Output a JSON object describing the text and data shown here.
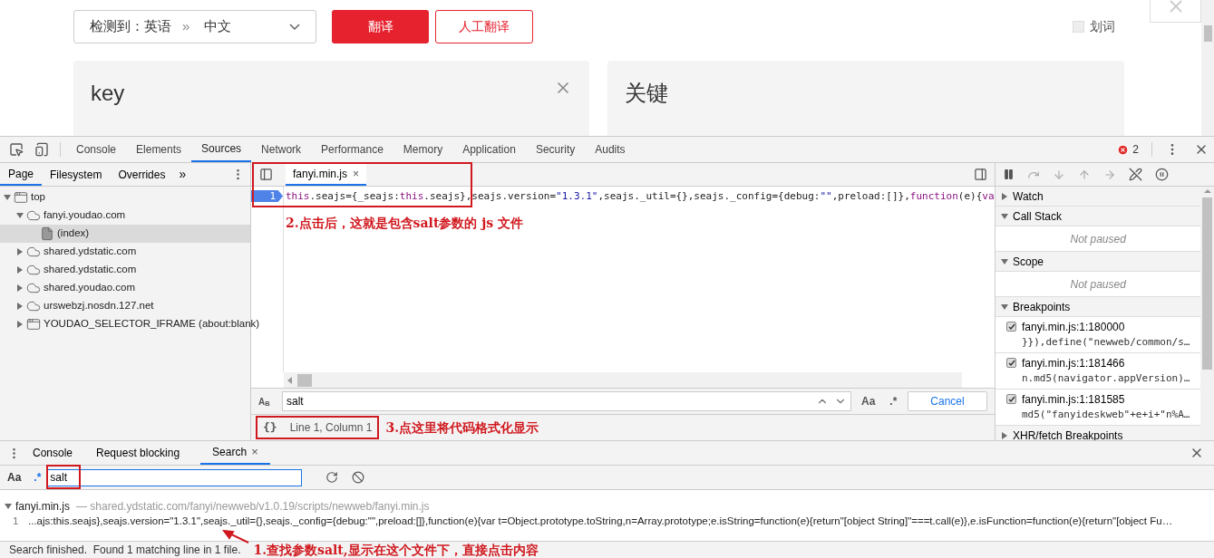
{
  "page": {
    "language_select": {
      "detected": "检测到：英语",
      "separator": "»",
      "target": "中文"
    },
    "translate_button": "翻译",
    "human_translate_button": "人工翻译",
    "word_pick": {
      "label": "划词",
      "checked": false
    },
    "source_text": "key",
    "result_text": "关键"
  },
  "devtools": {
    "error_count": "2",
    "tabs": [
      {
        "label": "Console",
        "selected": false
      },
      {
        "label": "Elements",
        "selected": false
      },
      {
        "label": "Sources",
        "selected": true
      },
      {
        "label": "Network",
        "selected": false
      },
      {
        "label": "Performance",
        "selected": false
      },
      {
        "label": "Memory",
        "selected": false
      },
      {
        "label": "Application",
        "selected": false
      },
      {
        "label": "Security",
        "selected": false
      },
      {
        "label": "Audits",
        "selected": false
      }
    ]
  },
  "navigator": {
    "tabs": [
      {
        "label": "Page",
        "selected": true
      },
      {
        "label": "Filesystem",
        "selected": false
      },
      {
        "label": "Overrides",
        "selected": false
      }
    ],
    "more": "»",
    "tree": [
      {
        "label": "top",
        "kind": "frame",
        "expanded": true,
        "selected": false,
        "children": [
          {
            "label": "fanyi.youdao.com",
            "kind": "domain",
            "expanded": true,
            "selected": false,
            "children": [
              {
                "label": "(index)",
                "kind": "file",
                "selected": true
              }
            ]
          },
          {
            "label": "shared.ydstatic.com",
            "kind": "domain",
            "expanded": false,
            "selected": false
          },
          {
            "label": "shared.ydstatic.com",
            "kind": "domain",
            "expanded": false,
            "selected": false
          },
          {
            "label": "shared.youdao.com",
            "kind": "domain",
            "expanded": false,
            "selected": false
          },
          {
            "label": "urswebzj.nosdn.127.net",
            "kind": "domain",
            "expanded": false,
            "selected": false
          },
          {
            "label": "YOUDAO_SELECTOR_IFRAME (about:blank)",
            "kind": "frame",
            "expanded": false,
            "selected": false
          }
        ]
      }
    ]
  },
  "editor": {
    "tab": {
      "label": "fanyi.min.js",
      "close": "×"
    },
    "line_number": "1",
    "code": [
      {
        "kind": "keyword",
        "text": "this"
      },
      {
        "kind": "plain",
        "text": ".seajs={_seajs:"
      },
      {
        "kind": "keyword",
        "text": "this"
      },
      {
        "kind": "plain",
        "text": ".seajs},seajs.version="
      },
      {
        "kind": "string",
        "text": "\"1.3.1\""
      },
      {
        "kind": "plain",
        "text": ",seajs._util={},seajs._config={debug:"
      },
      {
        "kind": "string",
        "text": "\"\""
      },
      {
        "kind": "plain",
        "text": ",preload:[]},"
      },
      {
        "kind": "keyword",
        "text": "function"
      },
      {
        "kind": "plain",
        "text": "(e){"
      },
      {
        "kind": "keyword",
        "text": "va"
      }
    ],
    "note": "2.点击后，这就是包含salt参数的 js 文件",
    "find": {
      "match_case": "A$_{B}$",
      "value": "salt",
      "options": [
        "Aa",
        ".*"
      ],
      "cancel": "Cancel"
    },
    "format_button": "{}",
    "cursor": "Line 1, Column 1",
    "format_note": "3.点这里将代码格式化显示"
  },
  "debugger": {
    "sections": [
      {
        "title": "Watch",
        "expanded": false
      },
      {
        "title": "Call Stack",
        "expanded": true,
        "message": "Not paused"
      },
      {
        "title": "Scope",
        "expanded": true,
        "message": "Not paused"
      },
      {
        "title": "Breakpoints",
        "expanded": true,
        "breakpoints": [
          {
            "location": "fanyi.min.js:1:180000",
            "code": "}}),define(\"newweb/common/s…",
            "checked": true
          },
          {
            "location": "fanyi.min.js:1:181466",
            "code": "n.md5(navigator.appVersion)…",
            "checked": true
          },
          {
            "location": "fanyi.min.js:1:181585",
            "code": "md5(\"fanyideskweb\"+e+i+\"n%A…",
            "checked": true
          }
        ]
      },
      {
        "title": "XHR/fetch Breakpoints",
        "expanded": false
      }
    ]
  },
  "drawer": {
    "tabs": [
      {
        "label": "Console",
        "selected": false
      },
      {
        "label": "Request blocking",
        "selected": false
      },
      {
        "label": "Search",
        "selected": true,
        "close": "×"
      }
    ],
    "search": {
      "options": [
        "Aa",
        ".*"
      ],
      "value": "salt"
    },
    "results": [
      {
        "file": "fanyi.min.js",
        "path": "— shared.ydstatic.com/fanyi/newweb/v1.0.19/scripts/newweb/fanyi.min.js",
        "expanded": true,
        "matches": [
          {
            "line": "1",
            "text": "...ajs:this.seajs},seajs.version=\"1.3.1\",seajs._util={},seajs._config={debug:\"\",preload:[]},function(e){var t=Object.prototype.toString,n=Array.prototype;e.isString=function(e){return\"[object String]\"===t.call(e)},e.isFunction=function(e){return\"[object Fu…"
          }
        ]
      }
    ],
    "status": "Search finished.  Found 1 matching line in 1 file.",
    "note": "1.查找参数salt,显示在这个文件下，直接点击内容"
  }
}
